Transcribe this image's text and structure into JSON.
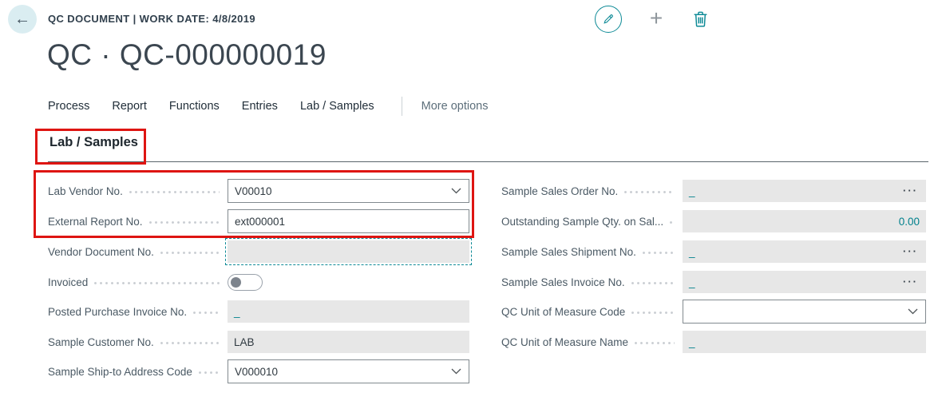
{
  "app_bar": {
    "title": "QC DOCUMENT | WORK DATE: 4/8/2019",
    "icons": {
      "back": "←",
      "edit": "edit-pencil",
      "add": "+",
      "delete": "trash"
    }
  },
  "page": {
    "title": "QC · QC-000000019"
  },
  "action_bar": {
    "items": [
      "Process",
      "Report",
      "Functions",
      "Entries",
      "Lab / Samples"
    ],
    "more": "More options"
  },
  "section": {
    "title": "Lab / Samples"
  },
  "form": {
    "left": [
      {
        "label": "Lab Vendor No.",
        "value": "V00010",
        "control": "combobox"
      },
      {
        "label": "External Report No.",
        "value": "ext000001",
        "control": "text-input"
      },
      {
        "label": "Vendor Document No.",
        "value": "",
        "control": "readonly-focused"
      },
      {
        "label": "Invoiced",
        "state": "off",
        "control": "toggle"
      },
      {
        "label": "Posted Purchase Invoice No.",
        "value": "_",
        "control": "readonly"
      },
      {
        "label": "Sample Customer No.",
        "value": "LAB",
        "control": "readonly"
      },
      {
        "label": "Sample Ship-to Address Code",
        "value": "V000010",
        "control": "combobox"
      }
    ],
    "right": [
      {
        "label": "Sample Sales Order No.",
        "value": "_",
        "trailing": "···",
        "control": "readonly-assist"
      },
      {
        "label": "Outstanding Sample Qty. on Sal...",
        "value": "0.00",
        "control": "readonly-number"
      },
      {
        "label": "Sample Sales Shipment No.",
        "value": "_",
        "trailing": "···",
        "control": "readonly-assist"
      },
      {
        "label": "Sample Sales Invoice No.",
        "value": "_",
        "trailing": "···",
        "control": "readonly-assist"
      },
      {
        "label": "QC Unit of Measure Code",
        "value": "",
        "control": "combobox"
      },
      {
        "label": "QC Unit of Measure Name",
        "value": "_",
        "control": "readonly"
      }
    ]
  },
  "colors": {
    "accent_teal": "#00808c",
    "field_gray": "#e7e7e7",
    "annotation_red": "#de1512",
    "back_circle": "#daedf1"
  }
}
